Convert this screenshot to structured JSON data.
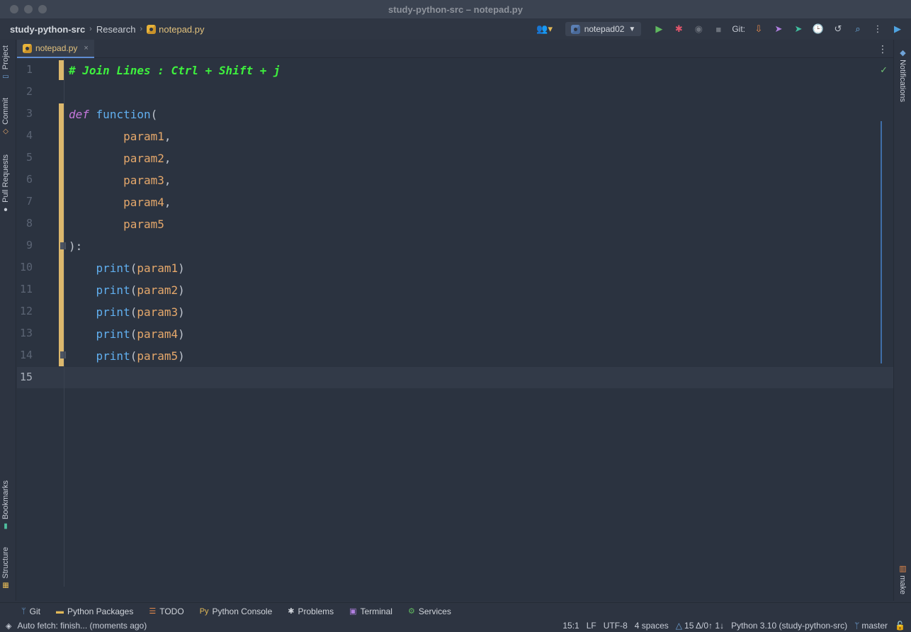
{
  "window": {
    "title": "study-python-src – notepad.py"
  },
  "breadcrumb": {
    "project": "study-python-src",
    "folder": "Research",
    "file": "notepad.py"
  },
  "toolbar": {
    "run_config": "notepad02",
    "git_label": "Git:"
  },
  "left_stripe": [
    "Project",
    "Commit",
    "Pull Requests",
    "Bookmarks",
    "Structure"
  ],
  "right_stripe": {
    "notifications": "Notifications",
    "make": "make"
  },
  "editor_tab": {
    "label": "notepad.py",
    "close": "×"
  },
  "editor": {
    "line_numbers": [
      "1",
      "2",
      "3",
      "4",
      "5",
      "6",
      "7",
      "8",
      "9",
      "10",
      "11",
      "12",
      "13",
      "14",
      "15"
    ],
    "code": {
      "l1": "# Join Lines : Ctrl + Shift + j",
      "l3_kw": "def",
      "l3_fn": "function",
      "l3_punct": "(",
      "l4": "param1",
      "l5": "param2",
      "l6": "param3",
      "l7": "param4",
      "l8": "param5",
      "comma": ",",
      "l9": "):",
      "print": "print",
      "open": "(",
      "close": ")",
      "p1": "param1",
      "p2": "param2",
      "p3": "param3",
      "p4": "param4",
      "p5": "param5"
    }
  },
  "bottom_tools": [
    "Git",
    "Python Packages",
    "TODO",
    "Python Console",
    "Problems",
    "Terminal",
    "Services"
  ],
  "status": {
    "message": "Auto fetch: finish... (moments ago)",
    "position": "15:1",
    "line_sep": "LF",
    "encoding": "UTF-8",
    "indent": "4 spaces",
    "vcs_changes": "15 Δ/0↑ 1↓",
    "interpreter": "Python 3.10 (study-python-src)",
    "branch": "master"
  }
}
